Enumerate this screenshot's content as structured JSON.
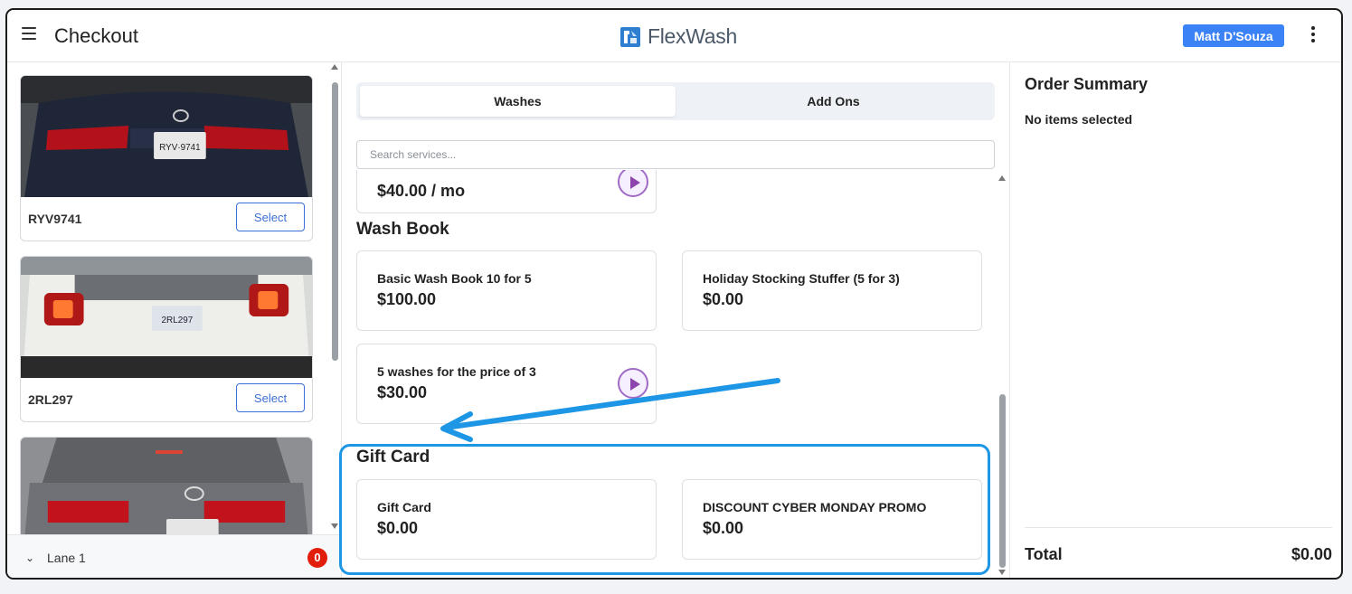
{
  "header": {
    "title": "Checkout",
    "logo_text": "FlexWash",
    "user_name": "Matt D'Souza"
  },
  "vehicles": [
    {
      "plate": "RYV9741",
      "select_label": "Select"
    },
    {
      "plate": "2RL297",
      "select_label": "Select"
    },
    {
      "plate": "",
      "select_label": ""
    }
  ],
  "lane": {
    "label": "Lane 1",
    "count": "0"
  },
  "tabs": [
    {
      "label": "Washes",
      "active": true
    },
    {
      "label": "Add Ons",
      "active": false
    }
  ],
  "search": {
    "placeholder": "Search services..."
  },
  "services": {
    "partial_price": "$40.00 / mo",
    "sections": [
      {
        "title": "Wash Book",
        "items": [
          {
            "name": "Basic Wash Book 10 for 5",
            "price": "$100.00"
          },
          {
            "name": "Holiday Stocking Stuffer (5 for 3)",
            "price": "$0.00"
          },
          {
            "name": "5 washes for the price of 3",
            "price": "$30.00"
          }
        ]
      },
      {
        "title": "Gift Card",
        "items": [
          {
            "name": "Gift Card",
            "price": "$0.00"
          },
          {
            "name": "DISCOUNT CYBER MONDAY PROMO",
            "price": "$0.00"
          }
        ]
      }
    ]
  },
  "order": {
    "title": "Order Summary",
    "empty_text": "No items selected",
    "total_label": "Total",
    "total_value": "$0.00"
  },
  "colors": {
    "accent": "#3b82f6",
    "annotation": "#1e96e6",
    "badge": "#e11d0b",
    "play": "#8e44ad"
  }
}
